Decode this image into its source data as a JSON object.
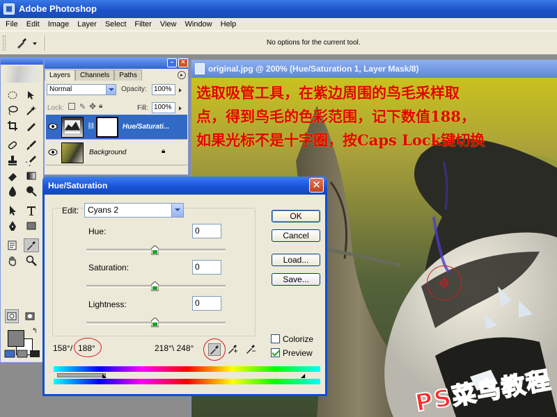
{
  "app": {
    "title": "Adobe Photoshop"
  },
  "menu": [
    "File",
    "Edit",
    "Image",
    "Layer",
    "Select",
    "Filter",
    "View",
    "Window",
    "Help"
  ],
  "options_bar": {
    "message": "No options for the current tool."
  },
  "layers_palette": {
    "tabs": [
      "Layers",
      "Channels",
      "Paths"
    ],
    "blend_mode": "Normal",
    "opacity_label": "Opacity:",
    "opacity": "100%",
    "lock_label": "Lock:",
    "fill_label": "Fill:",
    "fill": "100%",
    "layers": [
      {
        "name": "Hue/Saturati...",
        "active": true
      },
      {
        "name": "Background",
        "active": false
      }
    ]
  },
  "document": {
    "title": "original.jpg @ 200% (Hue/Saturation 1, Layer Mask/8)",
    "annotation_lines": [
      "选取吸管工具，在紫边周围的鸟毛采样取",
      "点，得到鸟毛的色彩范围，记下数值188，",
      "如果光标不是十字圈，按Caps Lock键切换"
    ],
    "watermark": "PS菜鸟教程"
  },
  "dialog": {
    "title": "Hue/Saturation",
    "edit_label": "Edit:",
    "edit_value": "Cyans 2",
    "hue_label": "Hue:",
    "hue_value": "0",
    "saturation_label": "Saturation:",
    "saturation_value": "0",
    "lightness_label": "Lightness:",
    "lightness_value": "0",
    "range_left": "158°/",
    "range_left_highlight": "188°",
    "range_right": "218°\\ 248°",
    "buttons": {
      "ok": "OK",
      "cancel": "Cancel",
      "load": "Load...",
      "save": "Save..."
    },
    "colorize_label": "Colorize",
    "colorize_checked": false,
    "preview_label": "Preview",
    "preview_checked": true
  },
  "colors": {
    "annotation": "#e00000",
    "highlight_ring": "#d21c1c",
    "titlebar": "#1d53c9",
    "fg_swatch": "#808080",
    "bg_swatch": "#ffffff"
  }
}
